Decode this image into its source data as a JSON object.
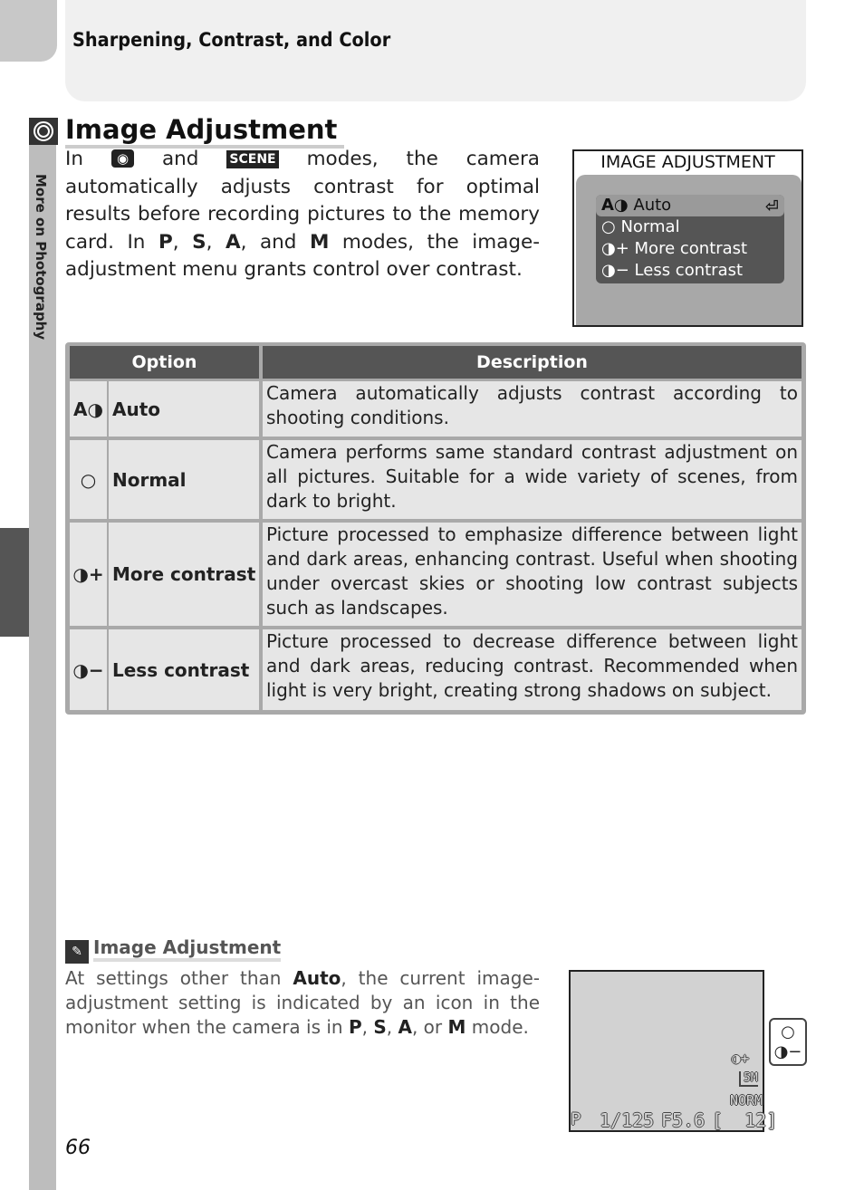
{
  "header": {
    "section": "Sharpening, Contrast, and Color"
  },
  "side_tab": "More on Photography",
  "title": "Image Adjustment",
  "intro": {
    "p1": "In",
    "and": "and",
    "scene": "SCENE",
    "p2": "modes, the camera automatically adjusts contrast for optimal results before recording pictures to the memory card.  In",
    "P": "P",
    "S": "S",
    "A": "A",
    "and2": "and",
    "M": "M",
    "p3": "modes, the image-adjustment menu grants control over contrast."
  },
  "menu": {
    "title": "IMAGE ADJUSTMENT",
    "items": [
      {
        "icon": "A◑",
        "label": "Auto"
      },
      {
        "icon": "○",
        "label": "Normal"
      },
      {
        "icon": "◑+",
        "label": "More contrast"
      },
      {
        "icon": "◑−",
        "label": "Less contrast"
      }
    ],
    "return_icon": "⏎"
  },
  "table": {
    "headers": [
      "Option",
      "Description"
    ],
    "rows": [
      {
        "icon": "A◑",
        "option": "Auto",
        "description": "Camera automatically adjusts contrast according to shooting conditions."
      },
      {
        "icon": "○",
        "option": "Normal",
        "description": "Camera performs same standard contrast adjustment on all pictures.  Suitable for a wide variety of scenes, from dark to bright."
      },
      {
        "icon": "◑+",
        "option": "More contrast",
        "description": "Picture processed to emphasize difference between light and dark areas, enhancing contrast.  Useful when shooting under overcast skies or shooting low contrast subjects such as landscapes."
      },
      {
        "icon": "◑−",
        "option": "Less contrast",
        "description": "Picture processed to decrease difference between light and dark areas, reducing contrast.  Recommended when light is very bright, creating strong shadows on subject."
      }
    ]
  },
  "note": {
    "title": "Image Adjustment",
    "t1": "At settings other than",
    "auto": "Auto",
    "t2": ", the current image-adjustment setting is indicated by an icon in the monitor when the camera is in",
    "P": "P",
    "S": "S",
    "A": "A",
    "or": ", or",
    "M": "M",
    "t3": "mode."
  },
  "lcd": {
    "mode": "P",
    "shutter": "1/125",
    "aperture": "F5.6",
    "frames": "[  12]",
    "size": "5M",
    "quality": "NORM",
    "contrast_icon": "◑+",
    "callout_icons": [
      "○",
      "◑−"
    ]
  },
  "page_number": "66"
}
